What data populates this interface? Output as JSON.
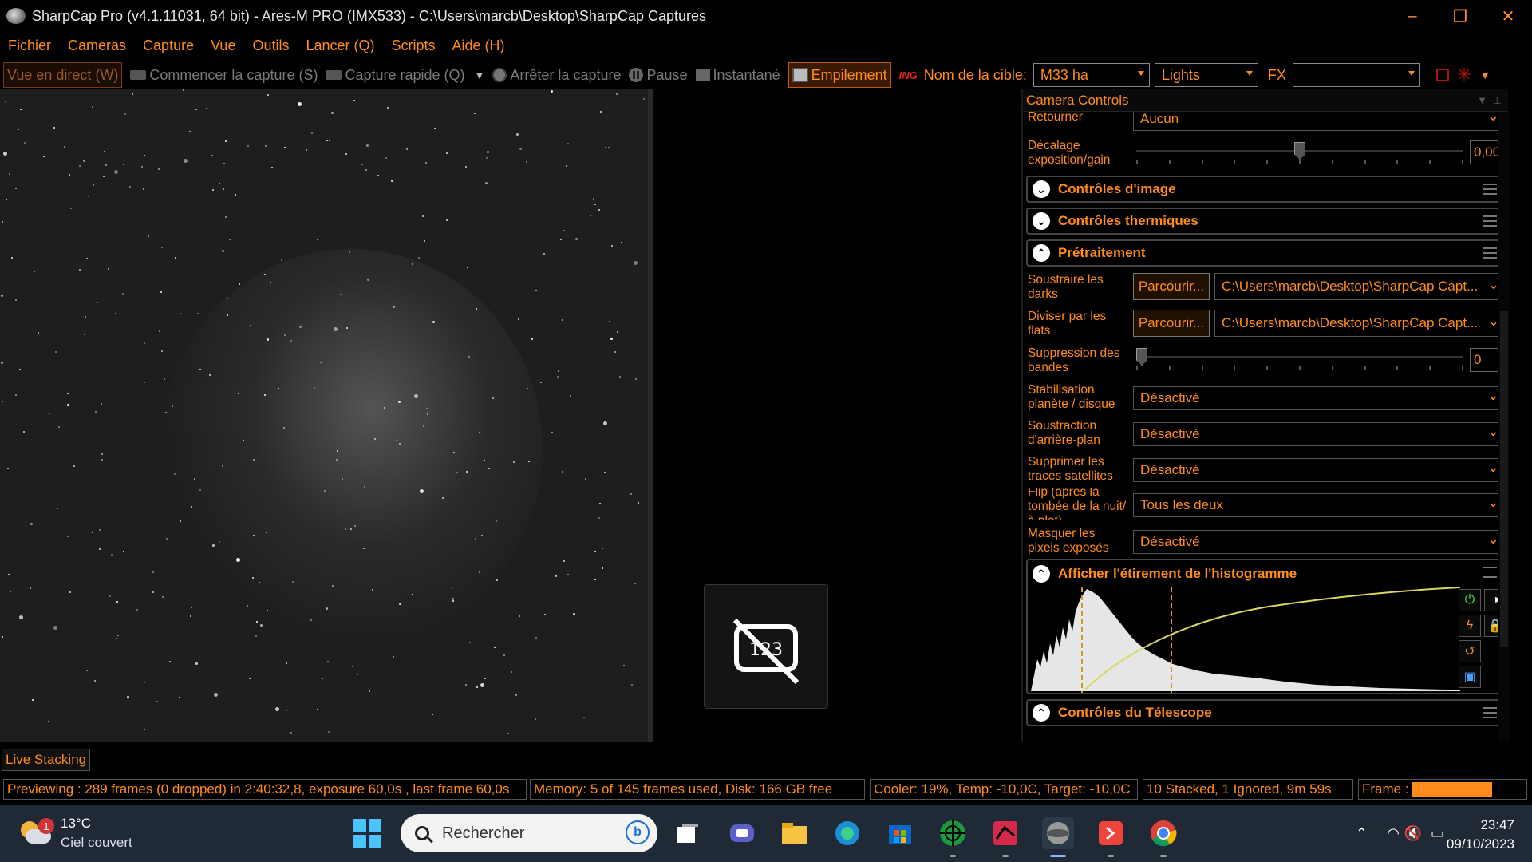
{
  "window": {
    "title": "SharpCap Pro (v4.1.11031, 64 bit) - Ares-M PRO (IMX533) - C:\\Users\\marcb\\Desktop\\SharpCap Captures"
  },
  "menu": [
    "Fichier",
    "Cameras",
    "Capture",
    "Vue",
    "Outils",
    "Lancer (Q)",
    "Scripts",
    "Aide (H)"
  ],
  "toolbar": {
    "live_view": "Vue en direct (W)",
    "start_capture": "Commencer la capture (S)",
    "quick_capture": "Capture rapide (Q)",
    "stop_capture": "Arrêter la capture",
    "pause": "Pause",
    "snapshot": "Instantané",
    "stacking": "Empilement",
    "ing_icon": "ING",
    "target_label": "Nom de la cible:",
    "target_value": "M33 ha",
    "frame_type": "Lights",
    "fx_label": "FX",
    "fx_value": ""
  },
  "panel": {
    "title": "Camera Controls",
    "flip_label": "Retourner",
    "flip_value": "Aucun",
    "exposure_offset_label": "Décalage exposition/gain",
    "exposure_offset_value": "0,00",
    "exposure_offset_fraction": 0.5,
    "sections": {
      "image_controls": "Contrôles d'image",
      "thermal_controls": "Contrôles thermiques",
      "preprocessing": "Prétraitement",
      "histogram": "Afficher l'étirement de l'histogramme",
      "telescope": "Contrôles du Télescope"
    },
    "preprocessing": {
      "darks_label": "Soustraire les darks",
      "darks_button": "Parcourir...",
      "darks_path": "C:\\Users\\marcb\\Desktop\\SharpCap Capt...",
      "flats_label": "Diviser par les flats",
      "flats_button": "Parcourir...",
      "flats_path": "C:\\Users\\marcb\\Desktop\\SharpCap Capt...",
      "banding_label": "Suppression des bandes",
      "banding_value": "0",
      "planet_label": "Stabilisation planète / disque",
      "planet_value": "Désactivé",
      "background_label": "Soustraction d'arrière-plan",
      "background_value": "Désactivé",
      "satellite_label": "Supprimer les traces satellites",
      "satellite_value": "Désactivé",
      "flip_after_label": "Flip (après la tombée de la nuit/à plat)",
      "flip_after_value": "Tous les deux",
      "mask_label": "Masquer les pixels exposés",
      "mask_value": "Désactivé"
    }
  },
  "live_stacking_tab": "Live Stacking",
  "status": {
    "preview": "Previewing : 289 frames (0 dropped) in 2:40:32,8, exposure 60,0s , last frame 60,0s",
    "memory": "Memory: 5 of 145 frames used, Disk: 166 GB free",
    "cooler": "Cooler: 19%, Temp: -10,0C, Target: -10,0C",
    "stacked": "10 Stacked, 1 Ignored, 9m 59s",
    "frame_label": "Frame :"
  },
  "taskbar": {
    "notification_count": "1",
    "temperature": "13°C",
    "weather": "Ciel couvert",
    "search_placeholder": "Rechercher",
    "time": "23:47",
    "date": "09/10/2023"
  },
  "colors": {
    "accent": "#ff8c1a",
    "taskbar": "#1f2a36"
  }
}
